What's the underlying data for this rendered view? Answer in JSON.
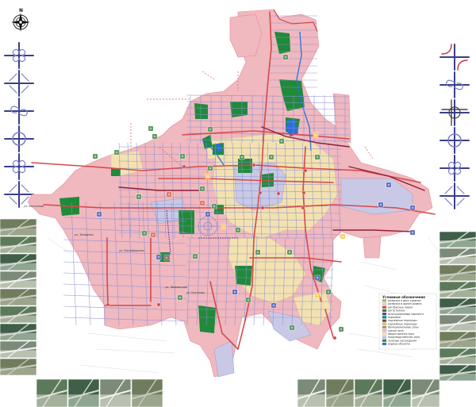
{
  "compass": {
    "north_letter": "N"
  },
  "street_labels": [
    "ул. Восточная",
    "ул. Западная",
    "ул. Кисловодская",
    "ул. Лермонтова",
    "ул. Кутузова"
  ],
  "legend": {
    "title": "Условные обозначения",
    "items": [
      {
        "label": "развязки в двух уровнях",
        "color": "#c8b44a"
      },
      {
        "label": "развязки в одном уровне",
        "color": "#d9d9d9"
      },
      {
        "label": "автобусные парки",
        "color": "#e14b2f"
      },
      {
        "label": "автостоянки",
        "color": "#2e7d32"
      },
      {
        "label": "многоуровневые паркинги",
        "color": "#3949ab"
      },
      {
        "label": "парковки",
        "color": "#00897b"
      },
      {
        "label": "подземные переходы",
        "color": "#6d4c41"
      },
      {
        "label": "надземные переходы",
        "color": "#fbc02d"
      },
      {
        "label": "Функциональные зоны",
        "color": "#999999"
      },
      {
        "label": "жилая зона",
        "color": "#f2b8bd"
      },
      {
        "label": "общественная зона",
        "color": "#f3e4b3"
      },
      {
        "label": "производственная зона",
        "color": "#c5c8e6"
      },
      {
        "label": "зелёные насаждения",
        "color": "#2e8b3e"
      },
      {
        "label": "водные объекты",
        "color": "#2f6fd6"
      }
    ]
  },
  "colors": {
    "residential": "#f0b8bf",
    "public": "#f3e2b0",
    "industrial": "#c9c9e6",
    "green": "#1f8a3a",
    "water": "#2b6fd9",
    "main_road": "#d64a4a",
    "highway": "#8e1f3a",
    "street": "#8c8ed0",
    "rail": "#6e3a8a"
  }
}
